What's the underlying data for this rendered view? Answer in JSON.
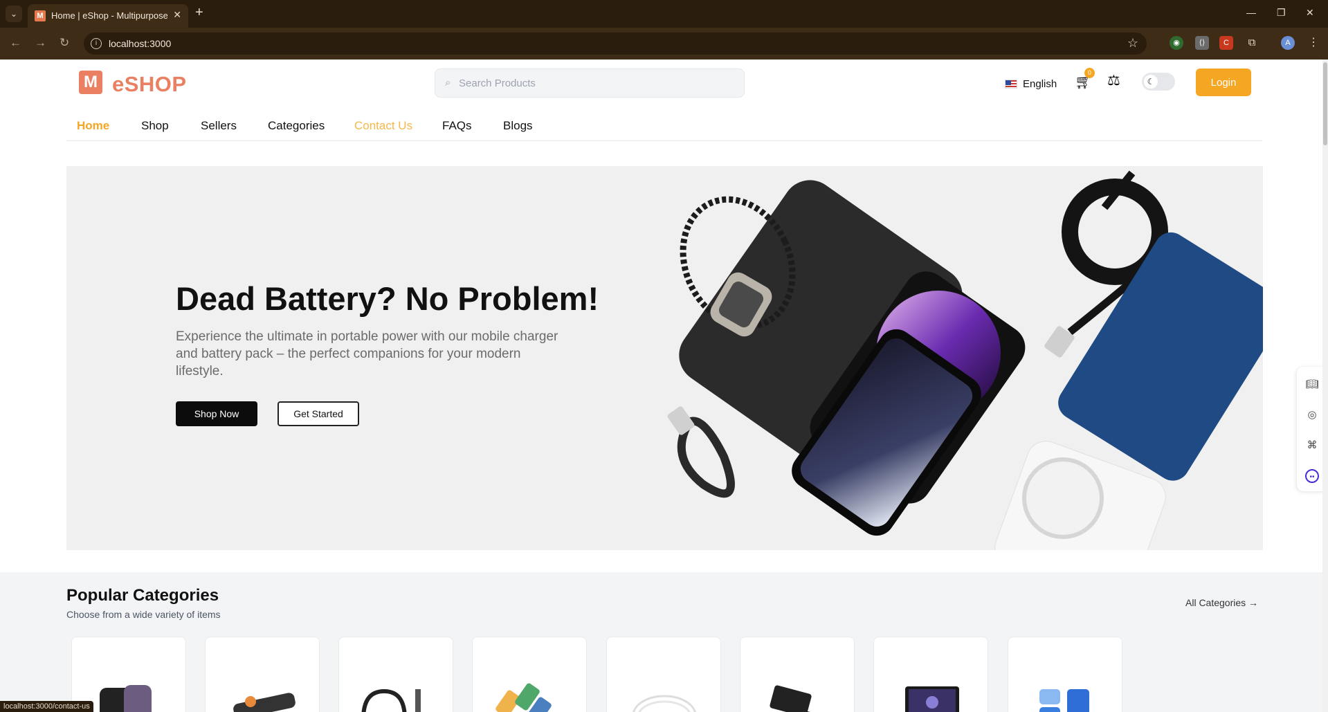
{
  "browser": {
    "tab_title": "Home | eShop - Multipurpose E",
    "url": "localhost:3000",
    "status_url": "localhost:3000/contact-us",
    "tab_icon_letter": "M"
  },
  "header": {
    "logo_text": "eSHOP",
    "logo_mark": "M",
    "search_placeholder": "Search Products",
    "language": "English",
    "cart_count": "0",
    "login_label": "Login"
  },
  "nav": {
    "items": [
      "Home",
      "Shop",
      "Sellers",
      "Categories",
      "Contact Us",
      "FAQs",
      "Blogs"
    ],
    "active": "Home",
    "hovered": "Contact Us"
  },
  "hero": {
    "title": "Dead Battery? No Problem!",
    "subtitle": "Experience the ultimate in portable power with our mobile charger and battery pack – the perfect companions for your modern lifestyle.",
    "primary_button": "Shop Now",
    "secondary_button": "Get Started"
  },
  "popular": {
    "title": "Popular Categories",
    "subtitle": "Choose from a wide variety of items",
    "all_link": "All Categories",
    "card_count": 8
  },
  "colors": {
    "accent": "#f5a623",
    "brand": "#ea7f62",
    "chrome": "#2b1d0e"
  }
}
